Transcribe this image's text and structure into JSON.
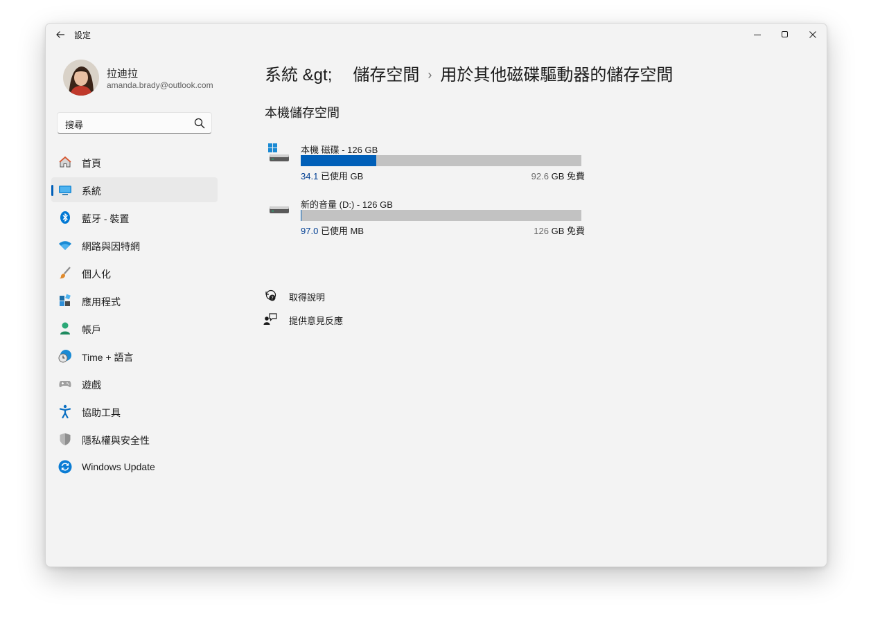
{
  "window": {
    "title": "設定"
  },
  "titlebar": {
    "minimize_icon": "minimize-icon",
    "maximize_icon": "maximize-icon",
    "close_icon": "close-icon"
  },
  "user": {
    "name": "拉迪拉",
    "email": "amanda.brady@outlook.com"
  },
  "search": {
    "value": "搜尋",
    "icon": "search-icon"
  },
  "sidebar": {
    "items": [
      {
        "label": "首頁",
        "icon": "home-icon"
      },
      {
        "label": "系統",
        "icon": "system-icon",
        "selected": true
      },
      {
        "label": "藍牙 - 裝置",
        "icon": "bluetooth-icon"
      },
      {
        "label": "網路與因特網",
        "icon": "wifi-icon"
      },
      {
        "label": "個人化",
        "icon": "brush-icon"
      },
      {
        "label": "應用程式",
        "icon": "apps-icon"
      },
      {
        "label": "帳戶",
        "icon": "account-icon"
      },
      {
        "label": "Time + 語言",
        "icon": "time-language-icon"
      },
      {
        "label": "遊戲",
        "icon": "gamepad-icon"
      },
      {
        "label": "協助工具",
        "icon": "accessibility-icon"
      },
      {
        "label": "隱私權與安全性",
        "icon": "shield-icon"
      },
      {
        "label": "Windows Update",
        "icon": "windows-update-icon"
      }
    ]
  },
  "breadcrumb": {
    "items": [
      "系統 &gt;",
      "儲存空間",
      "用於其他磁碟驅動器的儲存空間"
    ],
    "separator": "›"
  },
  "main": {
    "section_title": "本機儲存空間",
    "drives": [
      {
        "name": "本機   磁碟 - 126 GB",
        "used_value": "34.1",
        "used_label": "已使用 GB",
        "free_value": "92.6",
        "free_label": "GB 免費",
        "used_fraction": 0.27,
        "icon": "windows-drive-icon"
      },
      {
        "name": "新的音量 (D:) - 126 GB",
        "used_value": "97.0",
        "used_label": "已使用 MB",
        "free_value": "126",
        "free_label": "GB 免費",
        "used_fraction": 0.0008,
        "icon": "drive-icon"
      }
    ],
    "links": [
      {
        "label": "取得說明",
        "icon": "help-icon"
      },
      {
        "label": "提供意見反應",
        "icon": "feedback-icon"
      }
    ]
  },
  "colors": {
    "accent": "#005fb8",
    "bar_track": "#c2c2c2",
    "background": "#f3f3f3"
  }
}
